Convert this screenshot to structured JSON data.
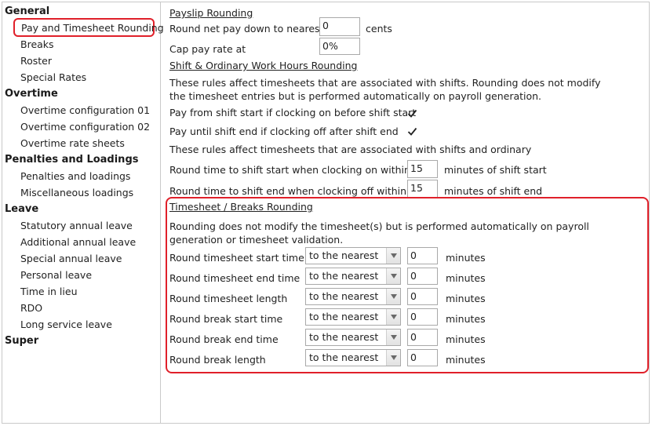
{
  "sidebar": {
    "categories": [
      {
        "label": "General",
        "items": [
          "Pay and Timesheet Rounding",
          "Breaks",
          "Roster",
          "Special Rates"
        ]
      },
      {
        "label": "Overtime",
        "items": [
          "Overtime configuration 01",
          "Overtime configuration 02",
          "Overtime rate sheets"
        ]
      },
      {
        "label": "Penalties and Loadings",
        "items": [
          "Penalties and loadings",
          "Miscellaneous loadings"
        ]
      },
      {
        "label": "Leave",
        "items": [
          "Statutory annual leave",
          "Additional annual leave",
          "Special annual leave",
          "Personal leave",
          "Time in lieu",
          "RDO",
          "Long service leave"
        ]
      },
      {
        "label": "Super",
        "items": []
      }
    ],
    "selected": "Pay and Timesheet Rounding"
  },
  "payslip": {
    "heading": "Payslip Rounding",
    "round_net_label": "Round net pay down to nearest",
    "round_net_value": "0",
    "round_net_unit": "cents",
    "cap_label": "Cap pay rate at",
    "cap_value": "0%"
  },
  "shift": {
    "heading": "Shift & Ordinary Work Hours Rounding",
    "description": "These rules affect timesheets that are associated with shifts. Rounding does not modify the timesheet entries but is performed automatically on payroll generation.",
    "pay_from_label": "Pay from shift start if clocking on before shift start",
    "pay_from_checked": true,
    "pay_until_label": "Pay until shift end if clocking off after shift end",
    "pay_until_checked": true,
    "description2": "These rules affect timesheets that are associated with shifts and ordinary",
    "round_start_label": "Round time to shift start when clocking on within",
    "round_start_value": "15",
    "round_start_unit": "minutes of shift start",
    "round_end_label": "Round time to shift end when clocking off within",
    "round_end_value": "15",
    "round_end_unit": "minutes of shift end"
  },
  "breaks": {
    "heading": "Timesheet / Breaks Rounding",
    "description": "Rounding does not modify the timesheet(s) but is performed automatically on payroll generation or timesheet validation.",
    "rows": [
      {
        "label": "Round timesheet start time",
        "mode": "to the nearest",
        "value": "0",
        "unit": "minutes"
      },
      {
        "label": "Round timesheet end time",
        "mode": "to the nearest",
        "value": "0",
        "unit": "minutes"
      },
      {
        "label": "Round timesheet length",
        "mode": "to the nearest",
        "value": "0",
        "unit": "minutes"
      },
      {
        "label": "Round break start time",
        "mode": "to the nearest",
        "value": "0",
        "unit": "minutes"
      },
      {
        "label": "Round break end time",
        "mode": "to the nearest",
        "value": "0",
        "unit": "minutes"
      },
      {
        "label": "Round break length",
        "mode": "to the nearest",
        "value": "0",
        "unit": "minutes"
      }
    ]
  },
  "colors": {
    "highlight": "#e0202a",
    "border": "#c9c9c9"
  }
}
